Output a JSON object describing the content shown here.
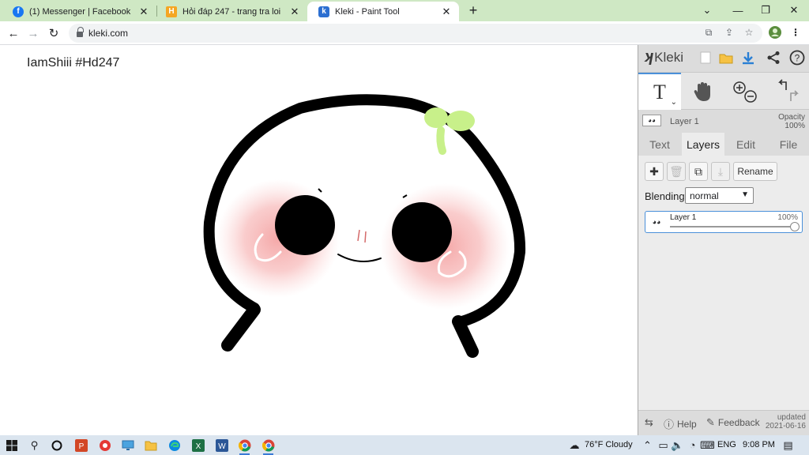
{
  "browser": {
    "tabs": [
      {
        "title": "(1) Messenger | Facebook",
        "icon": "facebook-icon",
        "color": "#1877f2",
        "active": false
      },
      {
        "title": "Hỏi đáp 247 - trang tra loi",
        "icon": "hoidap-icon",
        "color": "#f5a623",
        "active": false
      },
      {
        "title": "Kleki - Paint Tool",
        "icon": "kleki-icon",
        "color": "#2c6fd1",
        "active": true
      }
    ],
    "new_tab": "+",
    "url": "kleki.com"
  },
  "canvas": {
    "drawn_text": "IamShiii #Hd247"
  },
  "kleki": {
    "logo": "Kleki",
    "tools": [
      "T",
      "hand",
      "zoom",
      "undo-redo"
    ],
    "current_layer": "Layer 1",
    "opacity_label": "Opacity",
    "opacity_value": "100%",
    "tabs": [
      "Text",
      "Layers",
      "Edit",
      "File"
    ],
    "active_tab": "Layers",
    "rename_label": "Rename",
    "blending_label": "Blending",
    "blending_value": "normal",
    "layers": [
      {
        "name": "Layer 1",
        "opacity": "100%"
      }
    ],
    "footer": {
      "help": "Help",
      "feedback": "Feedback",
      "updated_label": "updated",
      "updated_date": "2021-06-16"
    }
  },
  "taskbar": {
    "weather": "76°F  Cloudy",
    "lang": "ENG",
    "time": "9:08 PM"
  }
}
